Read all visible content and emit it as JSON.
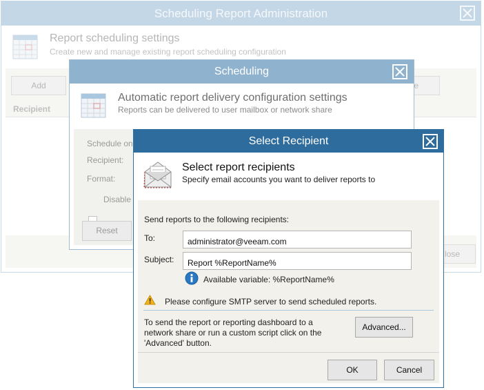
{
  "w1": {
    "title": "Scheduling Report Administration",
    "header_title": "Report scheduling settings",
    "header_subtitle": "Create new and manage existing report scheduling configuration",
    "add_label": "Add",
    "right_btn_label": "e",
    "col_recipient": "Recipient",
    "close_label": "lose"
  },
  "w2": {
    "title": "Scheduling",
    "header_title": "Automatic report delivery configuration settings",
    "header_subtitle": "Reports can be delivered to user mailbox or network share",
    "schedule_on": "Schedule on:",
    "recipient": "Recipient:",
    "format": "Format:",
    "disable": "Disable s",
    "reset_label": "Reset"
  },
  "w3": {
    "title": "Select Recipient",
    "header_title": "Select report recipients",
    "header_subtitle": "Specify email accounts you want to deliver reports to",
    "send_label": "Send reports to the following recipients:",
    "to_label": "To:",
    "to_value": "administrator@veeam.com",
    "subject_label": "Subject:",
    "subject_value": "Report %ReportName%",
    "variable_hint": "Available variable: %ReportName%",
    "smtp_warning": "Please configure SMTP server to send scheduled reports.",
    "advanced_text_1": "To send the report or reporting dashboard to a",
    "advanced_text_2": "network share or run a custom script click on the",
    "advanced_text_3": "'Advanced' button.",
    "advanced_label": "Advanced...",
    "ok_label": "OK",
    "cancel_label": "Cancel"
  },
  "colors": {
    "front_title_bg": "#2f6c9e",
    "middle_title_bg": "#8fb3cf",
    "back_title_bg": "#c4d7e6",
    "info_icon": "#2a78c2",
    "warning_icon": "#f2b320"
  },
  "icons": {
    "calendar": "calendar-icon",
    "envelope": "envelope-icon",
    "info": "info-icon",
    "warning": "warning-icon",
    "close": "close-icon"
  }
}
